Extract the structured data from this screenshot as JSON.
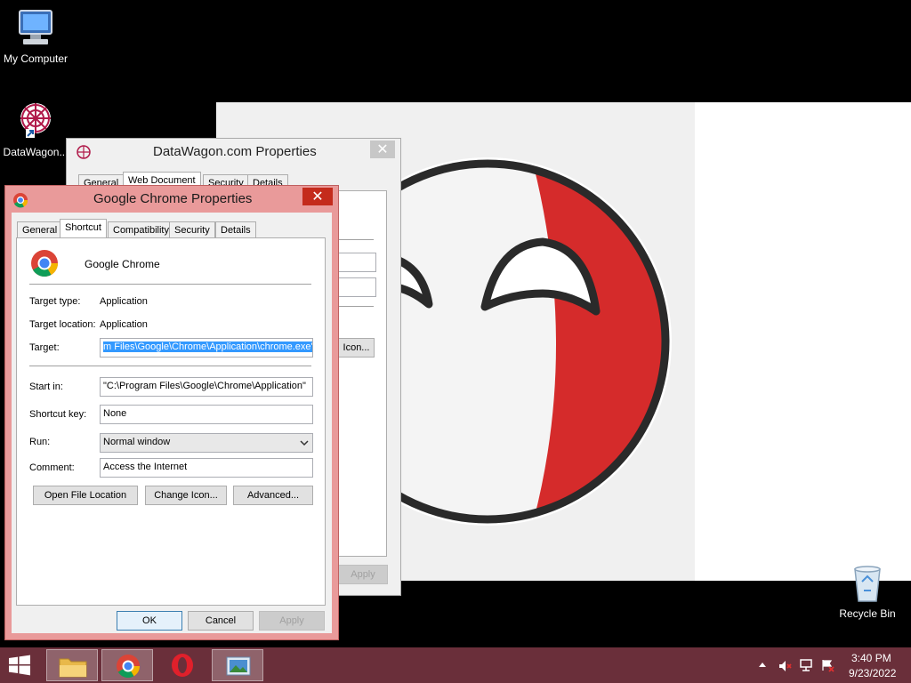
{
  "desktop": {
    "icons": [
      {
        "name": "my-computer",
        "label": "My Computer"
      },
      {
        "name": "datawagon",
        "label": "DataWagon..."
      },
      {
        "name": "recycle-bin",
        "label": "Recycle Bin"
      }
    ]
  },
  "back_window": {
    "title": "DataWagon.com Properties",
    "tabs": [
      "General",
      "Web Document",
      "Security",
      "Details"
    ],
    "change_icon_partial": "Icon...",
    "apply_label": "Apply"
  },
  "front_window": {
    "title": "Google Chrome Properties",
    "tabs": [
      "General",
      "Shortcut",
      "Compatibility",
      "Security",
      "Details"
    ],
    "app_name": "Google Chrome",
    "target_type_label": "Target type:",
    "target_type_value": "Application",
    "target_location_label": "Target location:",
    "target_location_value": "Application",
    "target_label": "Target:",
    "target_value": "m Files\\Google\\Chrome\\Application\\chrome.exe\"",
    "start_in_label": "Start in:",
    "start_in_value": "\"C:\\Program Files\\Google\\Chrome\\Application\"",
    "shortcut_key_label": "Shortcut key:",
    "shortcut_key_value": "None",
    "run_label": "Run:",
    "run_value": "Normal window",
    "comment_label": "Comment:",
    "comment_value": "Access the Internet",
    "open_file_location": "Open File Location",
    "change_icon": "Change Icon...",
    "advanced": "Advanced...",
    "ok": "OK",
    "cancel": "Cancel",
    "apply": "Apply"
  },
  "taskbar": {
    "time": "3:40 PM",
    "date": "9/23/2022"
  },
  "colors": {
    "taskbar": "#6a2f3a",
    "active_title": "#e99a9a",
    "close_red": "#c42b1c",
    "selection": "#3399ff",
    "ball_red": "#d52b2b"
  }
}
